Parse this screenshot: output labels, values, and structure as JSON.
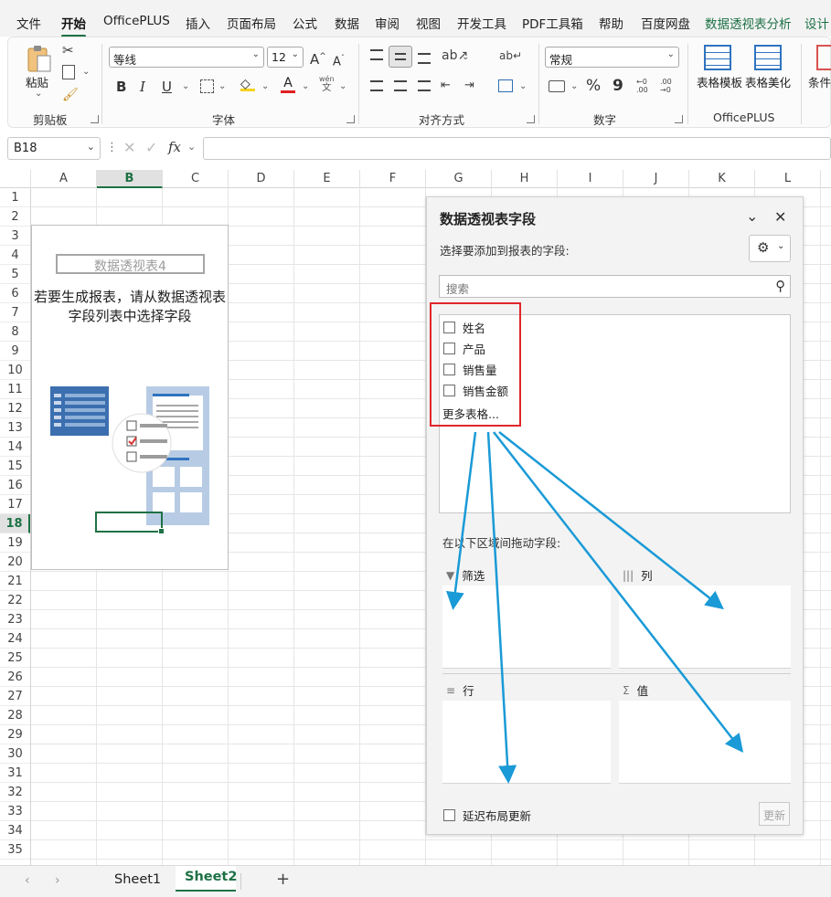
{
  "menu": {
    "items": [
      "文件",
      "开始",
      "OfficePLUS",
      "插入",
      "页面布局",
      "公式",
      "数据",
      "审阅",
      "视图",
      "开发工具",
      "PDF工具箱",
      "帮助",
      "百度网盘",
      "数据透视表分析",
      "设计"
    ],
    "active": "开始"
  },
  "ribbon": {
    "clipboard": {
      "label": "剪贴板",
      "paste_label": "粘贴"
    },
    "font": {
      "label": "字体",
      "font_name": "等线",
      "font_size": "12",
      "bold": "B",
      "italic": "I",
      "underline": "U",
      "grow": "A",
      "shrink": "A",
      "phonetic_top": "wén",
      "phonetic_bottom": "文",
      "font_color": "A"
    },
    "alignment": {
      "label": "对齐方式"
    },
    "number": {
      "label": "数字",
      "format": "常规",
      "percent": "%",
      "comma": "9",
      "inc_decimal": ".00",
      "dec_decimal": ".00"
    },
    "officeplus": {
      "label": "OfficePLUS",
      "table_template": "表格模板",
      "table_beautify": "表格美化",
      "conditional": "条件"
    }
  },
  "formula_bar": {
    "name_box": "B18",
    "fx": "fx",
    "formula": ""
  },
  "sheet": {
    "columns": [
      "A",
      "B",
      "C",
      "D",
      "E",
      "F",
      "G",
      "H",
      "I",
      "J",
      "K",
      "L"
    ],
    "selected_column": "B",
    "rows": [
      "1",
      "2",
      "3",
      "4",
      "5",
      "6",
      "7",
      "8",
      "9",
      "10",
      "11",
      "12",
      "13",
      "14",
      "15",
      "16",
      "17",
      "18",
      "19",
      "20",
      "21",
      "22",
      "23",
      "24",
      "25",
      "26",
      "27",
      "28",
      "29",
      "30",
      "31",
      "32",
      "33",
      "34",
      "35"
    ],
    "selected_row": "18"
  },
  "pivot_placeholder": {
    "name": "数据透视表4",
    "message": "若要生成报表，请从数据透视表字段列表中选择字段"
  },
  "pane": {
    "title": "数据透视表字段",
    "subtitle": "选择要添加到报表的字段:",
    "search_placeholder": "搜索",
    "fields": [
      {
        "label": "姓名",
        "checked": false
      },
      {
        "label": "产品",
        "checked": false
      },
      {
        "label": "销售量",
        "checked": false
      },
      {
        "label": "销售金额",
        "checked": false
      }
    ],
    "more_tables": "更多表格...",
    "drag_hint": "在以下区域间拖动字段:",
    "zones": {
      "filter": "筛选",
      "columns": "列",
      "rows": "行",
      "values": "值"
    },
    "defer_label": "延迟布局更新",
    "update_label": "更新"
  },
  "tabs": {
    "sheets": [
      "Sheet1",
      "Sheet2"
    ],
    "active": "Sheet2",
    "add": "+"
  },
  "colors": {
    "accent": "#1e7145",
    "arrow": "#1a9ad6",
    "highlight_box": "#e0262b"
  }
}
